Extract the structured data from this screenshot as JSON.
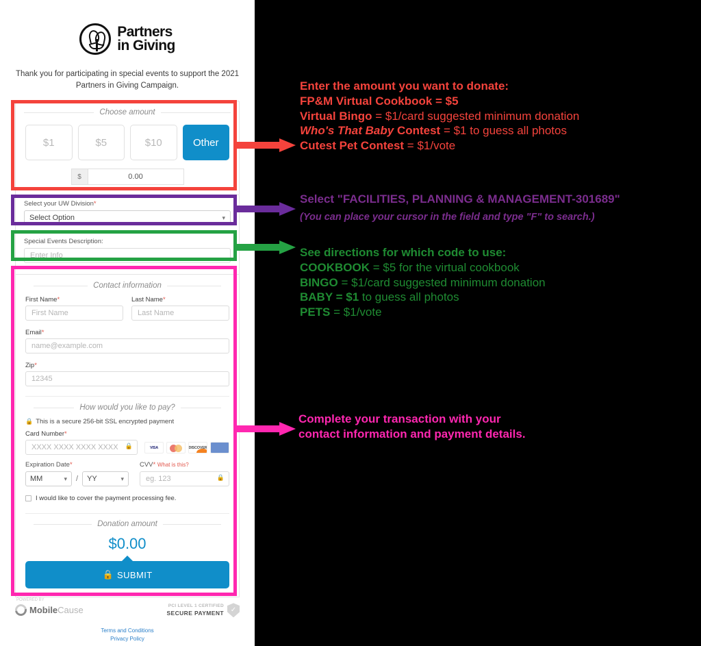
{
  "form": {
    "logo": {
      "line1": "Partners",
      "line2": "in Giving",
      "icon": "partners-in-giving-logo"
    },
    "intro": "Thank you for participating in special events to support the 2021 Partners in Giving Campaign.",
    "amount_section": {
      "legend": "Choose amount",
      "buttons": [
        {
          "label": "$1",
          "selected": false
        },
        {
          "label": "$5",
          "selected": false
        },
        {
          "label": "$10",
          "selected": false
        },
        {
          "label": "Other",
          "selected": true
        }
      ],
      "currency_symbol": "$",
      "custom_value": "0.00"
    },
    "division": {
      "label": "Select your UW Division",
      "required_mark": "*",
      "selected": "Select Option",
      "caret": "chevron-down-icon"
    },
    "special_events": {
      "label": "Special Events Description:",
      "placeholder": "Enter Info",
      "value": ""
    },
    "contact": {
      "legend": "Contact information",
      "first_name": {
        "label": "First Name",
        "placeholder": "First Name"
      },
      "last_name": {
        "label": "Last Name",
        "placeholder": "Last Name"
      },
      "email": {
        "label": "Email",
        "placeholder": "name@example.com"
      },
      "zip": {
        "label": "Zip",
        "placeholder": "12345"
      },
      "required_mark": "*"
    },
    "payment": {
      "legend": "How would you like to pay?",
      "secure_note": "This is a secure 256-bit SSL encrypted payment",
      "card_number": {
        "label": "Card Number",
        "placeholder": "XXXX XXXX XXXX XXXX"
      },
      "brands": [
        {
          "name": "visa",
          "label": "VISA"
        },
        {
          "name": "mastercard",
          "label": ""
        },
        {
          "name": "discover",
          "label": "DISCOVER"
        },
        {
          "name": "amex",
          "label": "AMERICAN EXPRESS"
        }
      ],
      "expiration": {
        "label": "Expiration Date",
        "month": "MM",
        "year": "YY",
        "separator": "/"
      },
      "cvv": {
        "label": "CVV",
        "help": "What is this?",
        "placeholder": "eg. 123"
      },
      "cover_fee": "I would like to cover the payment processing fee.",
      "required_mark": "*"
    },
    "totals": {
      "legend": "Donation amount",
      "amount": "$0.00",
      "submit_label": "SUBMIT"
    },
    "footer": {
      "powered_by": "POWERED BY",
      "provider_bold": "Mobile",
      "provider_light": "Cause",
      "pci_line1": "PCI LEVEL 1 CERTIFIED",
      "pci_line2": "SECURE PAYMENT",
      "terms": "Terms and Conditions",
      "privacy": "Privacy Policy"
    }
  },
  "annotations": {
    "red": {
      "color": "#f4433c",
      "lines": [
        {
          "bold": "Enter the amount you want to donate:",
          "rest": ""
        },
        {
          "bold": "FP&M Virtual Cookbook = $5",
          "rest": ""
        },
        {
          "bold": "Virtual Bingo",
          "rest": " = $1/card suggested minimum donation"
        },
        {
          "bold_italic": "Who's That Baby",
          "bold": " Contest",
          "rest": " = $1 to guess all photos"
        },
        {
          "bold": "Cutest Pet Contest",
          "rest": " = $1/vote"
        }
      ]
    },
    "purple": {
      "color": "#7b2d8e",
      "line1": "Select \"FACILITIES, PLANNING & MANAGEMENT-301689\"",
      "line2": "(You can place your cursor in the field and type \"F\" to search.)"
    },
    "green": {
      "color": "#1f8b32",
      "lines": [
        {
          "bold": "See directions for which code to use:",
          "rest": ""
        },
        {
          "bold": "COOKBOOK",
          "rest": " = $5 for the virtual cookbook"
        },
        {
          "bold": "BINGO",
          "rest": " = $1/card suggested minimum donation"
        },
        {
          "bold": "BABY = $1",
          "rest": " to guess all photos"
        },
        {
          "bold": "PETS",
          "rest": " = $1/vote"
        }
      ]
    },
    "pink": {
      "color": "#ff27b0",
      "line1": "Complete your transaction with your",
      "line2": "contact information and payment details."
    }
  }
}
